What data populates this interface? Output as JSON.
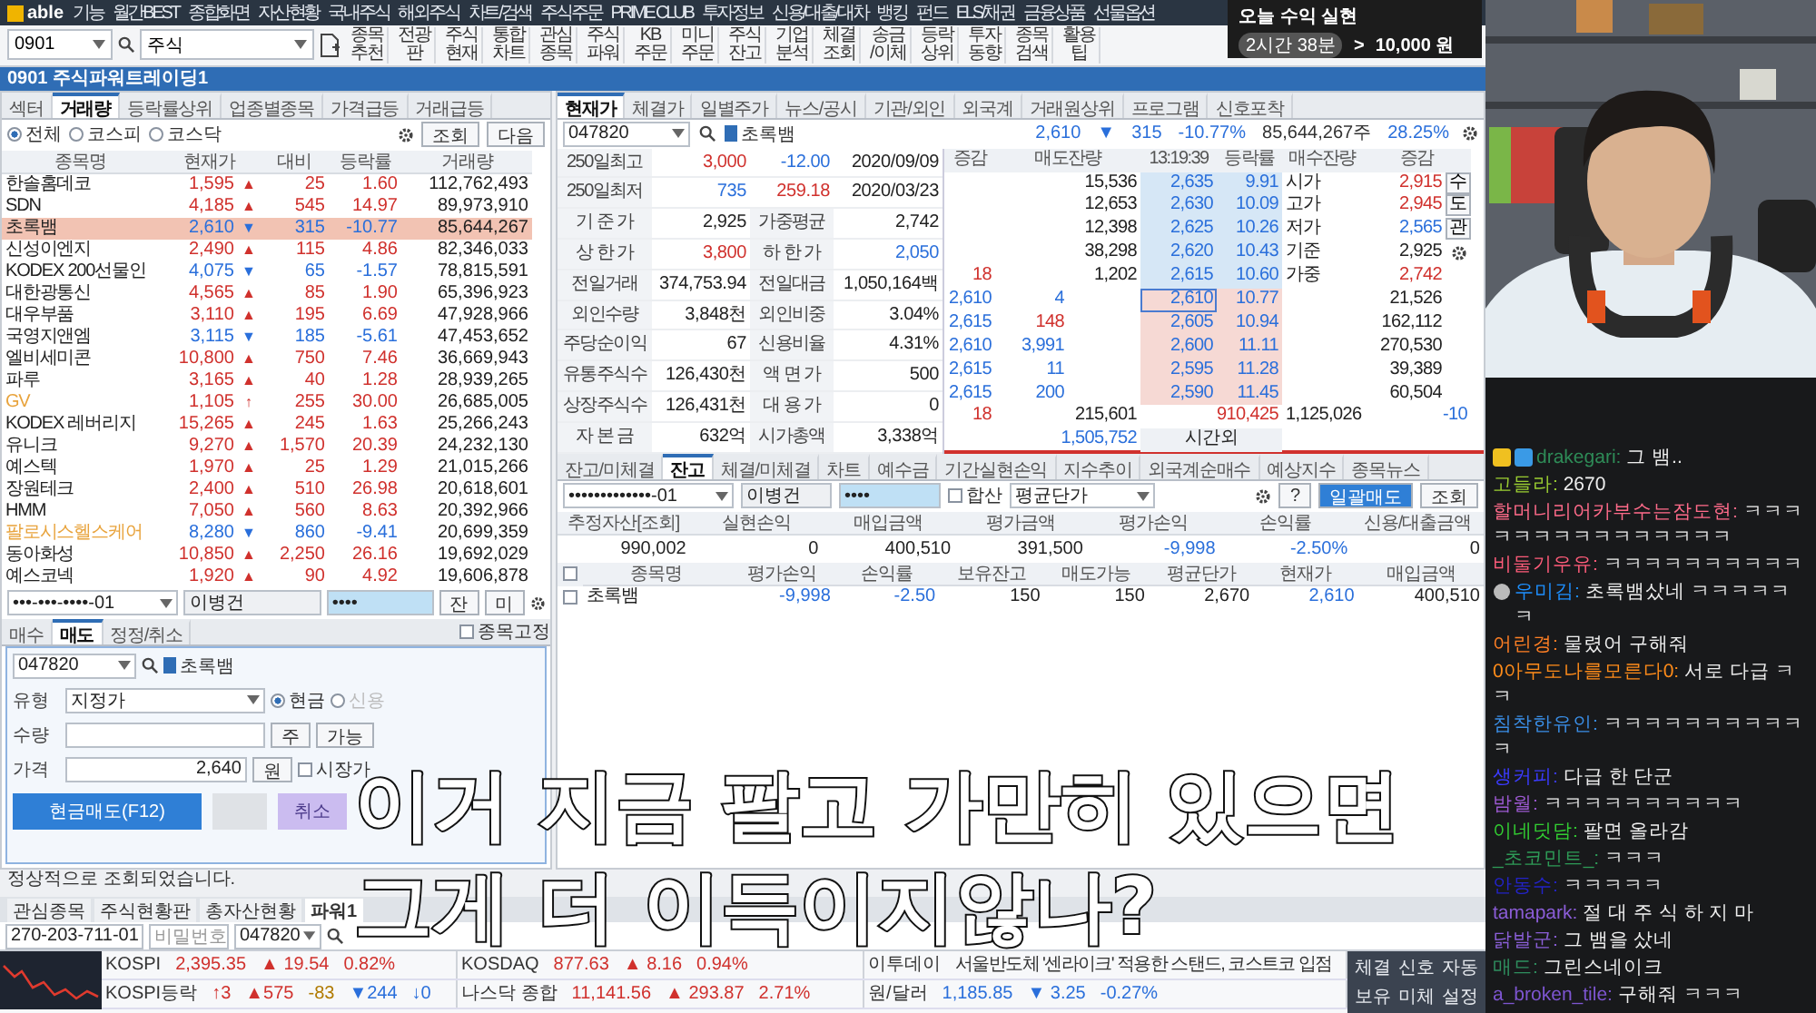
{
  "menu": {
    "logo": "able",
    "items": [
      "기능",
      "월간BEST",
      "종합화면",
      "자산현황",
      "국내주식",
      "해외주식",
      "차트/검색",
      "주식주문",
      "PRIME CLUB",
      "투자정보",
      "신용/대출/대차",
      "뱅킹",
      "펀드",
      "ELS/채권",
      "금융상품",
      "선물옵션"
    ]
  },
  "toolbar": {
    "screen_code": "0901",
    "search": "주식",
    "buttons": [
      "종목\n추천",
      "전광\n판",
      "주식\n현재",
      "통합\n차트",
      "관심\n종목",
      "주식\n파워",
      "KB\n주문",
      "미니\n주문",
      "주식\n잔고",
      "기업\n분석",
      "체결\n조회",
      "송금\n/이체",
      "등락\n상위",
      "투자\n동향",
      "종목\n검색",
      "활용\n팁"
    ]
  },
  "toast": {
    "title": "오늘 수익 실현",
    "time": "2시간 38분",
    "next": ">",
    "amount": "10,000 원"
  },
  "window": {
    "title": "0901 주식파워트레이딩1"
  },
  "ranking": {
    "tabs": [
      {
        "label": "섹터",
        "selected": false
      },
      {
        "label": "거래량",
        "selected": true
      },
      {
        "label": "등락률상위",
        "selected": false
      },
      {
        "label": "업종별종목",
        "selected": false
      },
      {
        "label": "가격급등",
        "selected": false
      },
      {
        "label": "거래급등",
        "selected": false
      }
    ],
    "markets": [
      {
        "label": "전체",
        "selected": true
      },
      {
        "label": "코스피",
        "selected": false
      },
      {
        "label": "코스닥",
        "selected": false
      }
    ],
    "buttons": [
      "조회",
      "다음"
    ],
    "columns": [
      "종목명",
      "현재가",
      "대비",
      "등락률",
      "거래량"
    ],
    "rows": [
      {
        "name": "한솔홈데코",
        "price": "1,595",
        "arrow": "▲",
        "rising": true,
        "change": "25",
        "rate": "1.60",
        "volume": "112,762,493",
        "selected": false
      },
      {
        "name": "SDN",
        "price": "4,185",
        "arrow": "▲",
        "rising": true,
        "change": "545",
        "rate": "14.97",
        "volume": "89,973,910",
        "selected": false
      },
      {
        "name": "초록뱀",
        "price": "2,610",
        "arrow": "▼",
        "rising": false,
        "change": "315",
        "rate": "-10.77",
        "volume": "85,644,267",
        "selected": true
      },
      {
        "name": "신성이엔지",
        "price": "2,490",
        "arrow": "▲",
        "rising": true,
        "change": "115",
        "rate": "4.86",
        "volume": "82,346,033",
        "selected": false
      },
      {
        "name": "KODEX 200선물인",
        "price": "4,075",
        "arrow": "▼",
        "rising": false,
        "change": "65",
        "rate": "-1.57",
        "volume": "78,815,591",
        "selected": false
      },
      {
        "name": "대한광통신",
        "price": "4,565",
        "arrow": "▲",
        "rising": true,
        "change": "85",
        "rate": "1.90",
        "volume": "65,396,923",
        "selected": false
      },
      {
        "name": "대우부품",
        "price": "3,110",
        "arrow": "▲",
        "rising": true,
        "change": "195",
        "rate": "6.69",
        "volume": "47,928,966",
        "selected": false
      },
      {
        "name": "국영지앤엠",
        "price": "3,115",
        "arrow": "▼",
        "rising": false,
        "change": "185",
        "rate": "-5.61",
        "volume": "47,453,652",
        "selected": false
      },
      {
        "name": "엘비세미콘",
        "price": "10,800",
        "arrow": "▲",
        "rising": true,
        "change": "750",
        "rate": "7.46",
        "volume": "36,669,943",
        "selected": false
      },
      {
        "name": "파루",
        "price": "3,165",
        "arrow": "▲",
        "rising": true,
        "change": "40",
        "rate": "1.28",
        "volume": "28,939,265",
        "selected": false
      },
      {
        "name": "GV",
        "price": "1,105",
        "arrow": "↑",
        "rising": true,
        "change": "255",
        "rate": "30.00",
        "volume": "26,685,005",
        "selected": false,
        "color": "#e8a33c"
      },
      {
        "name": "KODEX 레버리지",
        "price": "15,265",
        "arrow": "▲",
        "rising": true,
        "change": "245",
        "rate": "1.63",
        "volume": "25,266,243",
        "selected": false
      },
      {
        "name": "유니크",
        "price": "9,270",
        "arrow": "▲",
        "rising": true,
        "change": "1,570",
        "rate": "20.39",
        "volume": "24,232,130",
        "selected": false
      },
      {
        "name": "예스텍",
        "price": "1,970",
        "arrow": "▲",
        "rising": true,
        "change": "25",
        "rate": "1.29",
        "volume": "21,015,266",
        "selected": false
      },
      {
        "name": "장원테크",
        "price": "2,400",
        "arrow": "▲",
        "rising": true,
        "change": "510",
        "rate": "26.98",
        "volume": "20,618,601",
        "selected": false
      },
      {
        "name": "HMM",
        "price": "7,050",
        "arrow": "▲",
        "rising": true,
        "change": "560",
        "rate": "8.63",
        "volume": "20,392,966",
        "selected": false
      },
      {
        "name": "팔로시스헬스케어",
        "price": "8,280",
        "arrow": "▼",
        "rising": false,
        "change": "860",
        "rate": "-9.41",
        "volume": "20,699,359",
        "selected": false,
        "color": "#e8a33c"
      },
      {
        "name": "동아화성",
        "price": "10,850",
        "arrow": "▲",
        "rising": true,
        "change": "2,250",
        "rate": "26.16",
        "volume": "19,692,029",
        "selected": false
      },
      {
        "name": "예스코넥",
        "price": "1,920",
        "arrow": "▲",
        "rising": true,
        "change": "90",
        "rate": "4.92",
        "volume": "19,606,878",
        "selected": false
      }
    ]
  },
  "order": {
    "account": "•••-•••-••••-01",
    "owner": "이병건",
    "password": "••••",
    "side_buttons": [
      "잔",
      "미"
    ],
    "tabs": [
      {
        "label": "매수",
        "selected": false
      },
      {
        "label": "매도",
        "selected": true
      },
      {
        "label": "정정/취소",
        "selected": false
      }
    ],
    "lock_label": "종목고정",
    "lock": false,
    "code": "047820",
    "stock": "초록뱀",
    "type_label": "유형",
    "type": "지정가",
    "pay": [
      {
        "label": "현금",
        "selected": true,
        "disabled": false
      },
      {
        "label": "신용",
        "selected": false,
        "disabled": true
      }
    ],
    "qty_label": "수량",
    "qty_unit": "주",
    "qty_button": "가능",
    "price_label": "가격",
    "price": "2,640",
    "price_unit": "원",
    "market_label": "시장가",
    "market": false,
    "submit": "현금매도(F12)",
    "cancel": "취소"
  },
  "quote": {
    "tabs": [
      {
        "label": "현재가",
        "selected": true
      },
      {
        "label": "체결가",
        "selected": false
      },
      {
        "label": "일별주가",
        "selected": false
      },
      {
        "label": "뉴스/공시",
        "selected": false
      },
      {
        "label": "기관/외인",
        "selected": false
      },
      {
        "label": "외국계",
        "selected": false
      },
      {
        "label": "거래원상위",
        "selected": false
      },
      {
        "label": "프로그램",
        "selected": false
      },
      {
        "label": "신호포착",
        "selected": false
      }
    ],
    "code": "047820",
    "stock": "초록뱀",
    "head": {
      "price": "2,610",
      "arrow": "▼",
      "rising": false,
      "change": "315",
      "rate": "-10.77%",
      "volume": "85,644,267주",
      "ratio": "28.25%"
    },
    "info_rows": [
      [
        {
          "text": "250일최고",
          "kind": "label"
        },
        {
          "text": "3,000",
          "kind": "up"
        },
        {
          "text": "-12.00",
          "kind": "down"
        },
        {
          "text": "2020/09/09",
          "kind": "plain"
        }
      ],
      [
        {
          "text": "250일최저",
          "kind": "label"
        },
        {
          "text": "735",
          "kind": "down"
        },
        {
          "text": "259.18",
          "kind": "up"
        },
        {
          "text": "2020/03/23",
          "kind": "plain"
        }
      ],
      [
        {
          "text": "기 준 가",
          "kind": "label"
        },
        {
          "text": "2,925",
          "kind": "plain"
        },
        {
          "text": "가중평균",
          "kind": "label"
        },
        {
          "text": "2,742",
          "kind": "plain"
        }
      ],
      [
        {
          "text": "상 한 가",
          "kind": "label"
        },
        {
          "text": "3,800",
          "kind": "up"
        },
        {
          "text": "하 한 가",
          "kind": "label"
        },
        {
          "text": "2,050",
          "kind": "down"
        }
      ],
      [
        {
          "text": "전일거래",
          "kind": "label"
        },
        {
          "text": "374,753.94",
          "kind": "plain"
        },
        {
          "text": "전일대금",
          "kind": "label"
        },
        {
          "text": "1,050,164백",
          "kind": "plain"
        }
      ],
      [
        {
          "text": "외인수량",
          "kind": "label"
        },
        {
          "text": "3,848천",
          "kind": "plain"
        },
        {
          "text": "외인비중",
          "kind": "label"
        },
        {
          "text": "3.04%",
          "kind": "plain"
        }
      ],
      [
        {
          "text": "주당순이익",
          "kind": "label"
        },
        {
          "text": "67",
          "kind": "plain"
        },
        {
          "text": "신용비율",
          "kind": "label"
        },
        {
          "text": "4.31%",
          "kind": "plain"
        }
      ],
      [
        {
          "text": "유통주식수",
          "kind": "label"
        },
        {
          "text": "126,430천",
          "kind": "plain"
        },
        {
          "text": "액 면 가",
          "kind": "label"
        },
        {
          "text": "500",
          "kind": "plain"
        }
      ],
      [
        {
          "text": "상장주식수",
          "kind": "label"
        },
        {
          "text": "126,431천",
          "kind": "plain"
        },
        {
          "text": "대 용 가",
          "kind": "label"
        },
        {
          "text": "0",
          "kind": "plain"
        }
      ],
      [
        {
          "text": "자 본 금",
          "kind": "label"
        },
        {
          "text": "632억",
          "kind": "plain"
        },
        {
          "text": "시가총액",
          "kind": "label"
        },
        {
          "text": "3,338억",
          "kind": "plain"
        }
      ]
    ],
    "book": {
      "header": [
        "증감",
        "매도잔량",
        "13:19:39",
        "등락률",
        "매수잔량",
        "증감"
      ],
      "asks": [
        {
          "qty": "15,536",
          "price": "2,635",
          "rate": "9.91",
          "side_label": "시가",
          "side_value": "2,915",
          "side_rising": true
        },
        {
          "qty": "12,653",
          "price": "2,630",
          "rate": "10.09",
          "side_label": "고가",
          "side_value": "2,945",
          "side_rising": true
        },
        {
          "qty": "12,398",
          "price": "2,625",
          "rate": "10.26",
          "side_label": "저가",
          "side_value": "2,565",
          "side_rising": false
        },
        {
          "qty": "38,298",
          "price": "2,620",
          "rate": "10.43",
          "side_label": "기준",
          "side_value": "2,925"
        },
        {
          "delta": "18",
          "qty": "1,202",
          "price": "2,615",
          "rate": "10.60",
          "side_label": "가중",
          "side_value": "2,742",
          "side_rising": true
        }
      ],
      "bids": [
        {
          "tick_price": "2,610",
          "tick_qty": "4",
          "price": "2,610",
          "rate": "10.77",
          "qty": "21,526",
          "selected": true
        },
        {
          "tick_price": "2,615",
          "tick_qty": "148",
          "price": "2,605",
          "rate": "10.94",
          "qty": "162,112",
          "selected": false
        },
        {
          "tick_price": "2,610",
          "tick_qty": "3,991",
          "price": "2,600",
          "rate": "11.11",
          "qty": "270,530",
          "selected": false
        },
        {
          "tick_price": "2,615",
          "tick_qty": "11",
          "price": "2,595",
          "rate": "11.28",
          "qty": "39,389",
          "selected": false
        },
        {
          "tick_price": "2,615",
          "tick_qty": "200",
          "price": "2,590",
          "rate": "11.45",
          "qty": "60,504",
          "selected": false
        }
      ],
      "totals": [
        "18",
        "215,601",
        "910,425",
        "1,125,026",
        "-10"
      ],
      "after": [
        "1,505,752",
        "시간외"
      ],
      "side_buttons": [
        "수",
        "도",
        "관"
      ],
      "settings_button": true
    }
  },
  "balance": {
    "tabs": [
      {
        "label": "잔고/미체결",
        "selected": false
      },
      {
        "label": "잔고",
        "selected": true
      },
      {
        "label": "체결/미체결",
        "selected": false
      },
      {
        "label": "차트",
        "selected": false
      },
      {
        "label": "예수금",
        "selected": false
      },
      {
        "label": "기간실현손익",
        "selected": false
      },
      {
        "label": "지수추이",
        "selected": false
      },
      {
        "label": "외국계순매수",
        "selected": false
      },
      {
        "label": "예상지수",
        "selected": false
      },
      {
        "label": "종목뉴스",
        "selected": false
      }
    ],
    "account": "•••••••••••••-01",
    "owner": "이병건",
    "password": "••••",
    "sum_label": "합산",
    "sum": false,
    "price_mode": "평균단가",
    "help": "?",
    "bulk_sell": "일괄매도",
    "query": "조회",
    "summary": {
      "columns": [
        "추정자산[조회]",
        "실현손익",
        "매입금액",
        "평가금액",
        "평가손익",
        "손익률",
        "신용/대출금액"
      ],
      "values": [
        {
          "text": "990,002",
          "negative": false
        },
        {
          "text": "0",
          "negative": false
        },
        {
          "text": "400,510",
          "negative": false
        },
        {
          "text": "391,500",
          "negative": false
        },
        {
          "text": "-9,998",
          "negative": true
        },
        {
          "text": "-2.50%",
          "negative": true
        },
        {
          "text": "0",
          "negative": false
        }
      ]
    },
    "holdings": {
      "select_all": false,
      "columns": [
        "종목명",
        "평가손익",
        "손익률",
        "보유잔고",
        "매도가능",
        "평균단가",
        "현재가",
        "매입금액"
      ],
      "rows": [
        {
          "checked": false,
          "name": "초록뱀",
          "pnl": "-9,998",
          "pnl_rate": "-2.50",
          "held": "150",
          "sellable": "150",
          "avg_price": "2,670",
          "price": "2,610",
          "cost": "400,510"
        }
      ]
    }
  },
  "status": "정상적으로 조회되었습니다.",
  "bottom": {
    "tabs": [
      {
        "label": "관심종목",
        "selected": false
      },
      {
        "label": "주식현황판",
        "selected": false
      },
      {
        "label": "총자산현황",
        "selected": false
      },
      {
        "label": "파워1",
        "selected": true
      }
    ],
    "account": "270-203-711-01",
    "password_placeholder": "비밀번호",
    "code": "047820",
    "rows": [
      [
        {
          "kind": "index",
          "name": "KOSPI",
          "value": "2,395.35",
          "rising": true,
          "change": "▲ 19.54",
          "rate": "0.82%"
        },
        {
          "kind": "index",
          "name": "KOSDAQ",
          "value": "877.63",
          "rising": true,
          "change": "▲ 8.16",
          "rate": "0.94%"
        },
        {
          "kind": "news",
          "name": "이투데이",
          "text": "서울반도체 '센라이크' 적용한 스탠드, 코스트코 입점"
        }
      ],
      [
        {
          "kind": "breadth",
          "name": "KOSPI등락",
          "items": [
            "↑3",
            "▲575",
            "-83",
            "▼244",
            "↓0"
          ]
        },
        {
          "kind": "index",
          "name": "나스닥 종합",
          "value": "11,141.56",
          "rising": true,
          "change": "▲ 293.87",
          "rate": "2.71%"
        },
        {
          "kind": "index",
          "name": "원/달러",
          "value": "1,185.85",
          "rising": false,
          "change": "▼ 3.25",
          "rate": "-0.27%"
        }
      ]
    ],
    "quick": [
      "체결",
      "신호",
      "자동",
      "보유",
      "미체",
      "설정"
    ]
  },
  "webcam": {
    "kind": "picture"
  },
  "chat": [
    {
      "user": "drakegari:",
      "color": "#2e8b57",
      "text": "그 뱀..",
      "kind": "badges"
    },
    {
      "user": "고들라:",
      "color": "#9acd32",
      "text": "2670",
      "kind": "plain"
    },
    {
      "user": "할머니리어카부수는잠도현:",
      "color": "#ff6b8a",
      "text": "ㅋㅋㅋㅋㅋㅋㅋㅋㅋㅋㅋㅋㅋㅋㅋ",
      "kind": "plain"
    },
    {
      "user": "비둘기우유:",
      "color": "#ff5c7a",
      "text": "ㅋㅋㅋㅋㅋㅋㅋㅋㅋㅋ",
      "kind": "plain"
    },
    {
      "user": "우미김:",
      "color": "#1e90ff",
      "text": "초록뱀샀네 ㅋㅋㅋㅋㅋㅋ",
      "kind": "emote"
    },
    {
      "user": "어린경:",
      "color": "#ff7f24",
      "text": "물렸어 구해줘",
      "kind": "plain"
    },
    {
      "user": "0아무도나를모른다0:",
      "color": "#ff8c1a",
      "text": "서로 다급 ㅋㅋ",
      "kind": "plain"
    },
    {
      "user": "침착한유인:",
      "color": "#3a8ee6",
      "text": "ㅋㅋㅋㅋㅋㅋㅋㅋㅋㅋㅋ",
      "kind": "plain"
    },
    {
      "user": "생커피:",
      "color": "#3b3bff",
      "text": "다급 한 단군",
      "kind": "plain"
    },
    {
      "user": "밤월:",
      "color": "#9b59d0",
      "text": "ㅋㅋㅋㅋㅋㅋㅋㅋㅋㅋ",
      "kind": "plain"
    },
    {
      "user": "이네딧담:",
      "color": "#32cd32",
      "text": "팔면 올라감",
      "kind": "plain"
    },
    {
      "user": "_초코민트_:",
      "color": "#2e9b57",
      "text": "ㅋㅋㅋ",
      "kind": "plain"
    },
    {
      "user": "안동수:",
      "color": "#2323c8",
      "text": "ㅋㅋㅋㅋㅋ",
      "kind": "plain"
    },
    {
      "user": "tamapark:",
      "color": "#8a5cd6",
      "text": "절 대 주 식 하 지 마",
      "kind": "plain"
    },
    {
      "user": "닭발군:",
      "color": "#8b5fd8",
      "text": "그 뱀을 샀네",
      "kind": "plain"
    },
    {
      "user": "매드:",
      "color": "#2f8f5f",
      "text": "그린스네이크",
      "kind": "plain"
    },
    {
      "user": "a_broken_tile:",
      "color": "#7d55d0",
      "text": "구해줘 ㅋㅋㅋ",
      "kind": "plain"
    }
  ],
  "subtitles": [
    "이거 지금 팔고 가만히 있으면",
    "그게 더 이득이지않나?"
  ]
}
